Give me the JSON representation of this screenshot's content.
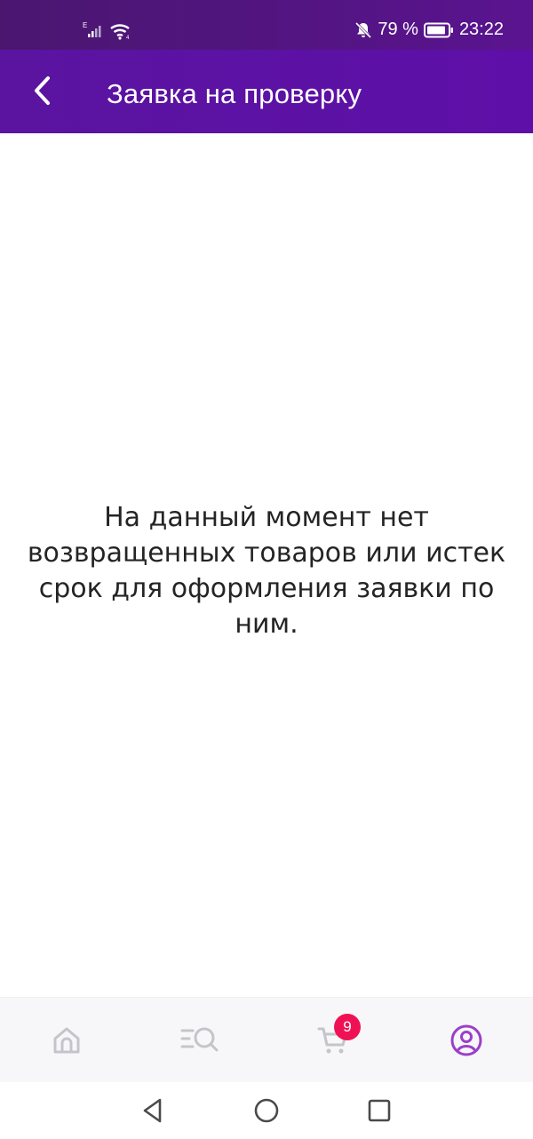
{
  "status_bar": {
    "network_label": "E",
    "battery_percent": "79 %",
    "time": "23:22",
    "icons": [
      "signal-icon",
      "wifi-icon",
      "bell-muted-icon",
      "battery-icon"
    ]
  },
  "header": {
    "title": "Заявка на проверку",
    "back_icon": "chevron-left-icon"
  },
  "main": {
    "empty_message": "На данный момент нет возвращенных товаров или истек срок для оформления заявки по ним."
  },
  "bottom_nav": {
    "items": [
      {
        "icon": "home-icon",
        "active": false
      },
      {
        "icon": "catalog-search-icon",
        "active": false
      },
      {
        "icon": "cart-icon",
        "active": false,
        "badge": "9"
      },
      {
        "icon": "profile-icon",
        "active": true
      }
    ]
  },
  "system_nav": {
    "icons": [
      "back-triangle-icon",
      "home-circle-icon",
      "recent-square-icon"
    ]
  },
  "colors": {
    "header_bg": "#5a14a0",
    "status_bg": "#4a1670",
    "badge_bg": "#f01155",
    "active_icon": "#9b3fc9",
    "inactive_icon": "#c4c4cc"
  }
}
